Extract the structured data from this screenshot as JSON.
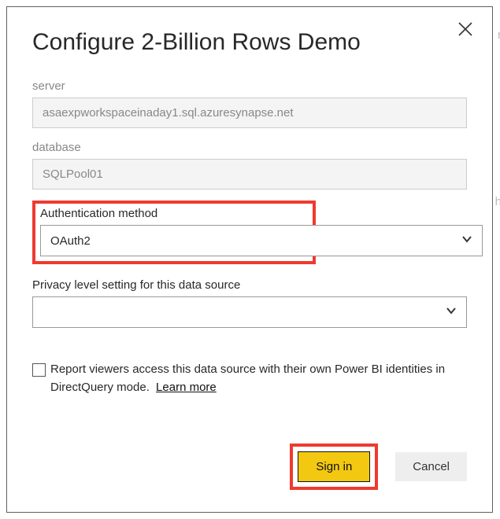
{
  "dialog": {
    "title": "Configure 2-Billion Rows Demo",
    "server_label": "server",
    "server_value": "asaexpworkspaceinaday1.sql.azuresynapse.net",
    "database_label": "database",
    "database_value": "SQLPool01",
    "auth_label": "Authentication method",
    "auth_value": "OAuth2",
    "privacy_label": "Privacy level setting for this data source",
    "privacy_value": "",
    "viewer_check_text": "Report viewers access this data source with their own Power BI identities in DirectQuery mode.",
    "learn_more": "Learn more",
    "signin_label": "Sign in",
    "cancel_label": "Cancel"
  },
  "highlight": {
    "color": "#ef3a2f"
  }
}
